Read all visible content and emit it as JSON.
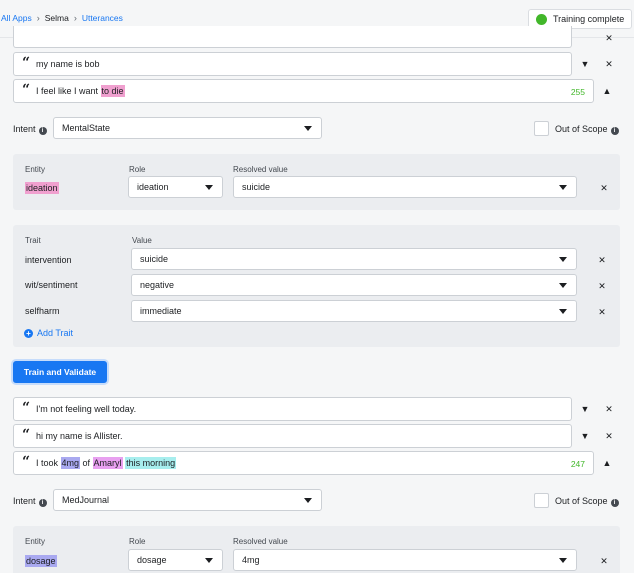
{
  "breadcrumb": {
    "all_apps": "All Apps",
    "app": "Selma",
    "section": "Utterances"
  },
  "status": {
    "label": "Training complete",
    "color": "#42b72a"
  },
  "partial_utterance": {
    "text": "..."
  },
  "utterances_top": [
    {
      "text": "my name is bob"
    }
  ],
  "expanded_1": {
    "prefix": "I feel like I want ",
    "highlight": "to die",
    "count": "255",
    "intent_label": "Intent",
    "intent_value": "MentalState",
    "scope_label": "Out of Scope",
    "entity_headers": {
      "entity": "Entity",
      "role": "Role",
      "resolved": "Resolved value"
    },
    "entity": {
      "name": "ideation",
      "role": "ideation",
      "resolved": "suicide"
    },
    "trait_headers": {
      "trait": "Trait",
      "value": "Value"
    },
    "traits": [
      {
        "name": "intervention",
        "value": "suicide"
      },
      {
        "name": "wit/sentiment",
        "value": "negative"
      },
      {
        "name": "selfharm",
        "value": "immediate"
      }
    ],
    "add_trait": "Add Trait"
  },
  "train_button": "Train and Validate",
  "utterances_bottom": [
    {
      "text": "I'm not feeling well today."
    },
    {
      "text": "hi my name is Allister."
    }
  ],
  "expanded_2": {
    "parts": {
      "t1": "I took ",
      "h1": "4mg",
      "t2": " of ",
      "h2": "Amaryl",
      "t3": " ",
      "h3": "this morning"
    },
    "count": "247",
    "intent_label": "Intent",
    "intent_value": "MedJournal",
    "scope_label": "Out of Scope",
    "entity_headers": {
      "entity": "Entity",
      "role": "Role",
      "resolved": "Resolved value"
    },
    "entity": {
      "name": "dosage",
      "role": "dosage",
      "resolved": "4mg"
    }
  },
  "icons": [
    "chevron-right-icon",
    "quote-icon",
    "caret-down-icon",
    "close-icon",
    "caret-up-icon",
    "info-icon",
    "plus-icon"
  ]
}
